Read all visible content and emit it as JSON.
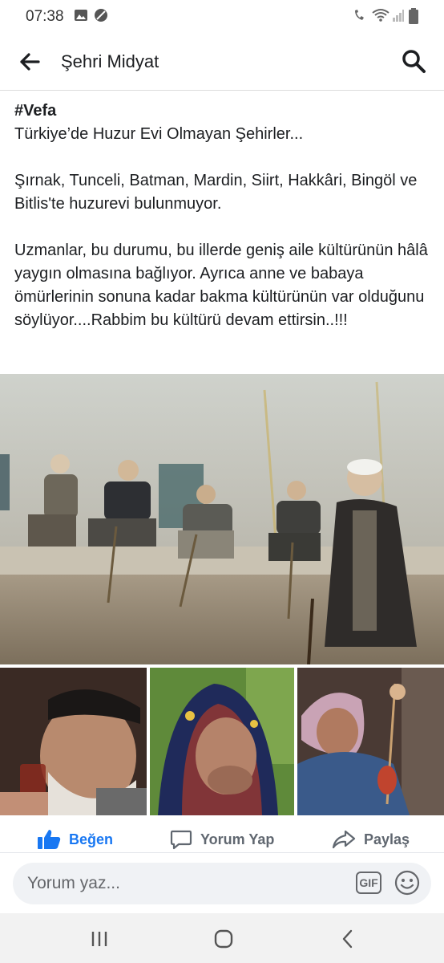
{
  "status_bar": {
    "time": "07:38"
  },
  "header": {
    "title": "Şehri Midyat"
  },
  "post": {
    "hashtag": "#Vefa",
    "line1": "Türkiye’de Huzur Evi Olmayan Şehirler...",
    "para2": "Şırnak, Tunceli, Batman, Mardin, Siirt, Hakkâri, Bingöl ve Bitlis'te huzurevi bulunmuyor.",
    "para3": "Uzmanlar, bu durumu, bu illerde geniş aile kültürünün hâlâ yaygın olmasına bağlıyor. Ayrıca anne ve babaya ömürlerinin sonuna kadar bakma kültürünün var olduğunu söylüyor....Rabbim bu kültürü devam ettirsin..!!!"
  },
  "actions": {
    "like": "Beğen",
    "comment": "Yorum Yap",
    "share": "Paylaş"
  },
  "comment_bar": {
    "placeholder": "Yorum yaz...",
    "gif_label": "GIF"
  },
  "colors": {
    "accent": "#1877f2",
    "text": "#1c1e21",
    "secondary": "#606770"
  }
}
